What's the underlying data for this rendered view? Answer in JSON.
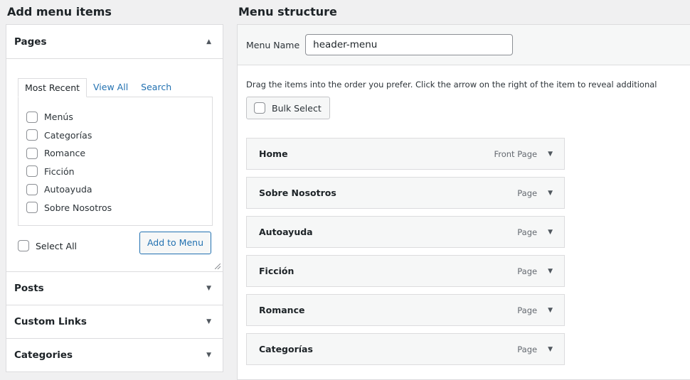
{
  "left": {
    "title": "Add menu items",
    "pages": {
      "header": "Pages",
      "tabs": [
        "Most Recent",
        "View All",
        "Search"
      ],
      "items": [
        "Menús",
        "Categorías",
        "Romance",
        "Ficción",
        "Autoayuda",
        "Sobre Nosotros"
      ],
      "select_all": "Select All",
      "add_button": "Add to Menu"
    },
    "sections": [
      "Posts",
      "Custom Links",
      "Categories"
    ]
  },
  "right": {
    "title": "Menu structure",
    "menu_name_label": "Menu Name",
    "menu_name_value": "header-menu",
    "instruction": "Drag the items into the order you prefer. Click the arrow on the right of the item to reveal additional",
    "bulk_select": "Bulk Select",
    "items": [
      {
        "title": "Home",
        "type": "Front Page"
      },
      {
        "title": "Sobre Nosotros",
        "type": "Page"
      },
      {
        "title": "Autoayuda",
        "type": "Page"
      },
      {
        "title": "Ficción",
        "type": "Page"
      },
      {
        "title": "Romance",
        "type": "Page"
      },
      {
        "title": "Categorías",
        "type": "Page"
      }
    ]
  },
  "icons": {
    "expanded": "arrow-up-icon",
    "collapsed": "arrow-down-icon"
  },
  "colors": {
    "accent": "#2271b1",
    "background": "#f0f0f1",
    "border": "#dcdcde"
  }
}
